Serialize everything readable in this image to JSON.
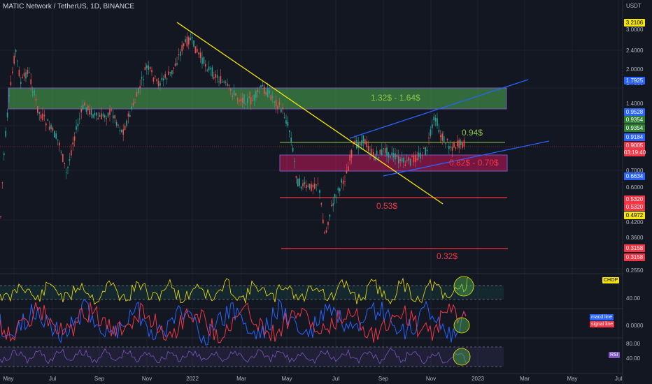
{
  "header": {
    "title": "MATIC Network / TetherUS, 1D, BINANCE",
    "currency": "USDT"
  },
  "price_axis": {
    "ticks": [
      "3.0000",
      "2.4000",
      "2.0000",
      "1.7000",
      "1.4000",
      "0.7000",
      "0.6000",
      "0.4200",
      "0.3600",
      "0.2550"
    ],
    "tags": [
      {
        "text": "3.2106",
        "bg": "#f5e50a",
        "fg": "#000000"
      },
      {
        "text": "1.7925",
        "bg": "#2962ff",
        "fg": "#ffffff"
      },
      {
        "text": "0.9528",
        "bg": "#2962ff",
        "fg": "#ffffff"
      },
      {
        "text": "0.9354",
        "bg": "#2e7d32",
        "fg": "#ffffff"
      },
      {
        "text": "0.9354",
        "bg": "#2e7d32",
        "fg": "#ffffff"
      },
      {
        "text": "0.9184",
        "bg": "#2962ff",
        "fg": "#ffffff"
      },
      {
        "text": "0.9005",
        "bg": "#f23645",
        "fg": "#ffffff"
      },
      {
        "text": "03:19:40",
        "bg": "#f23645",
        "fg": "#ffffff"
      },
      {
        "text": "0.6634",
        "bg": "#2962ff",
        "fg": "#ffffff"
      },
      {
        "text": "0.5320",
        "bg": "#f23645",
        "fg": "#ffffff"
      },
      {
        "text": "0.5320",
        "bg": "#f23645",
        "fg": "#ffffff"
      },
      {
        "text": "0.4972",
        "bg": "#f5e50a",
        "fg": "#000000"
      },
      {
        "text": "0.3158",
        "bg": "#f23645",
        "fg": "#ffffff"
      },
      {
        "text": "0.3158",
        "bg": "#f23645",
        "fg": "#ffffff"
      }
    ]
  },
  "time_axis": [
    "May",
    "Jul",
    "Sep",
    "Nov",
    "2022",
    "Mar",
    "May",
    "Jul",
    "Sep",
    "Nov",
    "2023",
    "Mar",
    "May",
    "Jul"
  ],
  "zones": {
    "green_zone": "1.32$ - 1.64$",
    "red_zone": "0.82$ - 0.70$",
    "level_094": "0.94$",
    "level_053": "0.53$",
    "level_032": "0.32$"
  },
  "indicators": {
    "chop": {
      "label": "CHOP",
      "tick": "40.00"
    },
    "macd": {
      "macd_label": "macd line",
      "signal_label": "signal line",
      "tick": "0.0000"
    },
    "rsi": {
      "label": "RSI",
      "tick_high": "80.00",
      "tick_low": "40.00"
    }
  },
  "colors": {
    "background": "#131722",
    "up": "#26a69a",
    "down": "#ef5350",
    "green_zone": "#4caf50",
    "red_zone": "#c2185b",
    "trendline_yellow": "#f5e50a",
    "channel_blue": "#2962ff",
    "level_red": "#f23645",
    "level_green": "#8bc34a"
  }
}
